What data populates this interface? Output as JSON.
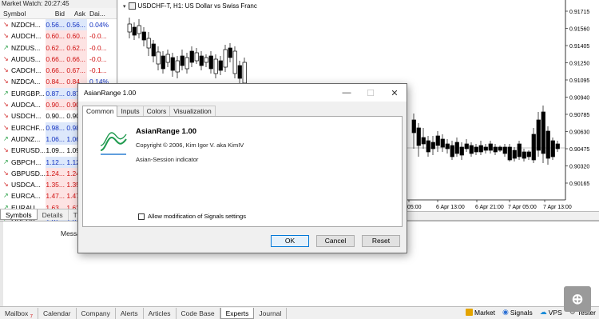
{
  "market_watch": {
    "title": "Market Watch: 20:27:45",
    "headers": {
      "symbol": "Symbol",
      "bid": "Bid",
      "ask": "Ask",
      "change": "Dai..."
    },
    "rows": [
      {
        "symbol": "NZDCH...",
        "dir": "down",
        "bid": "0.56...",
        "ask": "0.56...",
        "change": "0.04%",
        "tone": "blue"
      },
      {
        "symbol": "AUDCH...",
        "dir": "down",
        "bid": "0.60...",
        "ask": "0.60...",
        "change": "-0.0...",
        "tone": "red"
      },
      {
        "symbol": "NZDUS...",
        "dir": "up",
        "bid": "0.62...",
        "ask": "0.62...",
        "change": "-0.0...",
        "tone": "red"
      },
      {
        "symbol": "AUDUS...",
        "dir": "down",
        "bid": "0.66...",
        "ask": "0.66...",
        "change": "-0.0...",
        "tone": "red"
      },
      {
        "symbol": "CADCH...",
        "dir": "down",
        "bid": "0.66...",
        "ask": "0.67...",
        "change": "-0.1...",
        "tone": "red"
      },
      {
        "symbol": "NZDCA...",
        "dir": "down",
        "bid": "0.84...",
        "ask": "0.84...",
        "change": "0.14%",
        "tone": "red_blue"
      },
      {
        "symbol": "EURGBP...",
        "dir": "up",
        "bid": "0.87...",
        "ask": "0.87...",
        "change": "",
        "tone": "blue"
      },
      {
        "symbol": "AUDCA...",
        "dir": "down",
        "bid": "0.90...",
        "ask": "0.90...",
        "change": "",
        "tone": "red"
      },
      {
        "symbol": "USDCH...",
        "dir": "down",
        "bid": "0.90...",
        "ask": "0.90...",
        "change": "",
        "tone": "none"
      },
      {
        "symbol": "EURCHF...",
        "dir": "down",
        "bid": "0.98...",
        "ask": "0.98...",
        "change": "",
        "tone": "blue"
      },
      {
        "symbol": "AUDNZ...",
        "dir": "up",
        "bid": "1.06...",
        "ask": "1.06...",
        "change": "",
        "tone": "blue"
      },
      {
        "symbol": "EURUSD...",
        "dir": "down",
        "bid": "1.09...",
        "ask": "1.09...",
        "change": "",
        "tone": "none"
      },
      {
        "symbol": "GBPCH...",
        "dir": "up",
        "bid": "1.12...",
        "ask": "1.12...",
        "change": "",
        "tone": "blue"
      },
      {
        "symbol": "GBPUSD...",
        "dir": "down",
        "bid": "1.24...",
        "ask": "1.24...",
        "change": "",
        "tone": "red"
      },
      {
        "symbol": "USDCA...",
        "dir": "down",
        "bid": "1.35...",
        "ask": "1.35...",
        "change": "",
        "tone": "red"
      },
      {
        "symbol": "EURCA...",
        "dir": "up",
        "bid": "1.47...",
        "ask": "1.47...",
        "change": "",
        "tone": "red"
      },
      {
        "symbol": "EURAU...",
        "dir": "up",
        "bid": "1.63...",
        "ask": "1.63...",
        "change": "",
        "tone": "red"
      },
      {
        "symbol": "GBPCA...",
        "dir": "up",
        "bid": "1.67...",
        "ask": "1.67...",
        "change": "",
        "tone": "blue"
      }
    ],
    "tabs": [
      "Symbols",
      "Details",
      "Tr"
    ]
  },
  "chart": {
    "title": "USDCHF-T, H1:  US Dollar vs Swiss Franc",
    "price_labels": [
      "0.91715",
      "0.91560",
      "0.91405",
      "0.91250",
      "0.91095",
      "0.90940",
      "0.90785",
      "0.90630",
      "0.90475",
      "0.90320",
      "0.90165"
    ],
    "time_labels": [
      "05:00",
      "6 Apr 13:00",
      "6 Apr 21:00",
      "7 Apr 05:00",
      "7 Apr 13:00"
    ]
  },
  "terminal": {
    "column_header": "Messa"
  },
  "bottom_tabs": [
    {
      "label": "Mailbox",
      "badge": "7",
      "active": false
    },
    {
      "label": "Calendar",
      "badge": "",
      "active": false
    },
    {
      "label": "Company",
      "badge": "",
      "active": false
    },
    {
      "label": "Alerts",
      "badge": "",
      "active": false
    },
    {
      "label": "Articles",
      "badge": "",
      "active": false
    },
    {
      "label": "Code Base",
      "badge": "",
      "active": false
    },
    {
      "label": "Experts",
      "badge": "",
      "active": true
    },
    {
      "label": "Journal",
      "badge": "",
      "active": false
    }
  ],
  "status_right": [
    {
      "label": "Market",
      "icon": "market-icon"
    },
    {
      "label": "Signals",
      "icon": "signals-icon"
    },
    {
      "label": "VPS",
      "icon": "vps-icon"
    },
    {
      "label": "Tester",
      "icon": "tester-icon"
    }
  ],
  "dialog": {
    "title": "AsianRange 1.00",
    "tabs": [
      "Common",
      "Inputs",
      "Colors",
      "Visualization"
    ],
    "active_tab": "Common",
    "name": "AsianRange 1.00",
    "copyright": "Copyright © 2006, Kim Igor V. aka KimIV",
    "description": "Asian-Session indicator",
    "checkbox_label": "Allow modification of Signals settings",
    "checkbox_checked": false,
    "buttons": {
      "ok": "OK",
      "cancel": "Cancel",
      "reset": "Reset"
    }
  }
}
